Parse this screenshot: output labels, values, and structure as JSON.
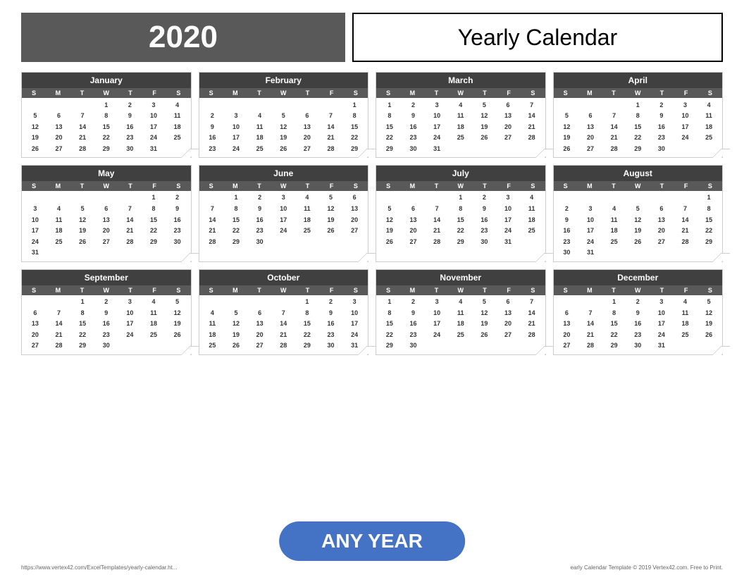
{
  "header": {
    "year": "2020",
    "title": "Yearly Calendar"
  },
  "footer": {
    "url": "https://www.vertex42.com/ExcelTemplates/yearly-calendar.ht...",
    "copyright": "early Calendar Template © 2019 Vertex42.com. Free to Print.",
    "any_year_label": "ANY YEAR"
  },
  "day_labels": [
    "S",
    "M",
    "T",
    "W",
    "T",
    "F",
    "S"
  ],
  "months": [
    {
      "name": "January",
      "weeks": [
        [
          "",
          "",
          "",
          "1",
          "2",
          "3",
          "4"
        ],
        [
          "5",
          "6",
          "7",
          "8",
          "9",
          "10",
          "11"
        ],
        [
          "12",
          "13",
          "14",
          "15",
          "16",
          "17",
          "18"
        ],
        [
          "19",
          "20",
          "21",
          "22",
          "23",
          "24",
          "25"
        ],
        [
          "26",
          "27",
          "28",
          "29",
          "30",
          "31",
          ""
        ]
      ]
    },
    {
      "name": "February",
      "weeks": [
        [
          "",
          "",
          "",
          "",
          "",
          "",
          "1"
        ],
        [
          "2",
          "3",
          "4",
          "5",
          "6",
          "7",
          "8"
        ],
        [
          "9",
          "10",
          "11",
          "12",
          "13",
          "14",
          "15"
        ],
        [
          "16",
          "17",
          "18",
          "19",
          "20",
          "21",
          "22"
        ],
        [
          "23",
          "24",
          "25",
          "26",
          "27",
          "28",
          "29"
        ]
      ]
    },
    {
      "name": "March",
      "weeks": [
        [
          "1",
          "2",
          "3",
          "4",
          "5",
          "6",
          "7"
        ],
        [
          "8",
          "9",
          "10",
          "11",
          "12",
          "13",
          "14"
        ],
        [
          "15",
          "16",
          "17",
          "18",
          "19",
          "20",
          "21"
        ],
        [
          "22",
          "23",
          "24",
          "25",
          "26",
          "27",
          "28"
        ],
        [
          "29",
          "30",
          "31",
          "",
          "",
          "",
          ""
        ]
      ]
    },
    {
      "name": "April",
      "weeks": [
        [
          "",
          "",
          "",
          "1",
          "2",
          "3",
          "4"
        ],
        [
          "5",
          "6",
          "7",
          "8",
          "9",
          "10",
          "11"
        ],
        [
          "12",
          "13",
          "14",
          "15",
          "16",
          "17",
          "18"
        ],
        [
          "19",
          "20",
          "21",
          "22",
          "23",
          "24",
          "25"
        ],
        [
          "26",
          "27",
          "28",
          "29",
          "30",
          "",
          ""
        ]
      ]
    },
    {
      "name": "May",
      "weeks": [
        [
          "",
          "",
          "",
          "",
          "",
          "1",
          "2"
        ],
        [
          "3",
          "4",
          "5",
          "6",
          "7",
          "8",
          "9"
        ],
        [
          "10",
          "11",
          "12",
          "13",
          "14",
          "15",
          "16"
        ],
        [
          "17",
          "18",
          "19",
          "20",
          "21",
          "22",
          "23"
        ],
        [
          "24",
          "25",
          "26",
          "27",
          "28",
          "29",
          "30"
        ],
        [
          "31",
          "",
          "",
          "",
          "",
          "",
          ""
        ]
      ]
    },
    {
      "name": "June",
      "weeks": [
        [
          "",
          "1",
          "2",
          "3",
          "4",
          "5",
          "6"
        ],
        [
          "7",
          "8",
          "9",
          "10",
          "11",
          "12",
          "13"
        ],
        [
          "14",
          "15",
          "16",
          "17",
          "18",
          "19",
          "20"
        ],
        [
          "21",
          "22",
          "23",
          "24",
          "25",
          "26",
          "27"
        ],
        [
          "28",
          "29",
          "30",
          "",
          "",
          "",
          ""
        ]
      ]
    },
    {
      "name": "July",
      "weeks": [
        [
          "",
          "",
          "",
          "1",
          "2",
          "3",
          "4"
        ],
        [
          "5",
          "6",
          "7",
          "8",
          "9",
          "10",
          "11"
        ],
        [
          "12",
          "13",
          "14",
          "15",
          "16",
          "17",
          "18"
        ],
        [
          "19",
          "20",
          "21",
          "22",
          "23",
          "24",
          "25"
        ],
        [
          "26",
          "27",
          "28",
          "29",
          "30",
          "31",
          ""
        ]
      ]
    },
    {
      "name": "August",
      "weeks": [
        [
          "",
          "",
          "",
          "",
          "",
          "",
          "1"
        ],
        [
          "2",
          "3",
          "4",
          "5",
          "6",
          "7",
          "8"
        ],
        [
          "9",
          "10",
          "11",
          "12",
          "13",
          "14",
          "15"
        ],
        [
          "16",
          "17",
          "18",
          "19",
          "20",
          "21",
          "22"
        ],
        [
          "23",
          "24",
          "25",
          "26",
          "27",
          "28",
          "29"
        ],
        [
          "30",
          "31",
          "",
          "",
          "",
          "",
          ""
        ]
      ]
    },
    {
      "name": "September",
      "weeks": [
        [
          "",
          "",
          "1",
          "2",
          "3",
          "4",
          "5"
        ],
        [
          "6",
          "7",
          "8",
          "9",
          "10",
          "11",
          "12"
        ],
        [
          "13",
          "14",
          "15",
          "16",
          "17",
          "18",
          "19"
        ],
        [
          "20",
          "21",
          "22",
          "23",
          "24",
          "25",
          "26"
        ],
        [
          "27",
          "28",
          "29",
          "30",
          "",
          "",
          ""
        ]
      ]
    },
    {
      "name": "October",
      "weeks": [
        [
          "",
          "",
          "",
          "",
          "1",
          "2",
          "3"
        ],
        [
          "4",
          "5",
          "6",
          "7",
          "8",
          "9",
          "10"
        ],
        [
          "11",
          "12",
          "13",
          "14",
          "15",
          "16",
          "17"
        ],
        [
          "18",
          "19",
          "20",
          "21",
          "22",
          "23",
          "24"
        ],
        [
          "25",
          "26",
          "27",
          "28",
          "29",
          "30",
          "31"
        ]
      ]
    },
    {
      "name": "November",
      "weeks": [
        [
          "1",
          "2",
          "3",
          "4",
          "5",
          "6",
          "7"
        ],
        [
          "8",
          "9",
          "10",
          "11",
          "12",
          "13",
          "14"
        ],
        [
          "15",
          "16",
          "17",
          "18",
          "19",
          "20",
          "21"
        ],
        [
          "22",
          "23",
          "24",
          "25",
          "26",
          "27",
          "28"
        ],
        [
          "29",
          "30",
          "",
          "",
          "",
          "",
          ""
        ]
      ]
    },
    {
      "name": "December",
      "weeks": [
        [
          "",
          "",
          "1",
          "2",
          "3",
          "4",
          "5"
        ],
        [
          "6",
          "7",
          "8",
          "9",
          "10",
          "11",
          "12"
        ],
        [
          "13",
          "14",
          "15",
          "16",
          "17",
          "18",
          "19"
        ],
        [
          "20",
          "21",
          "22",
          "23",
          "24",
          "25",
          "26"
        ],
        [
          "27",
          "28",
          "29",
          "30",
          "31",
          "",
          ""
        ]
      ]
    }
  ]
}
